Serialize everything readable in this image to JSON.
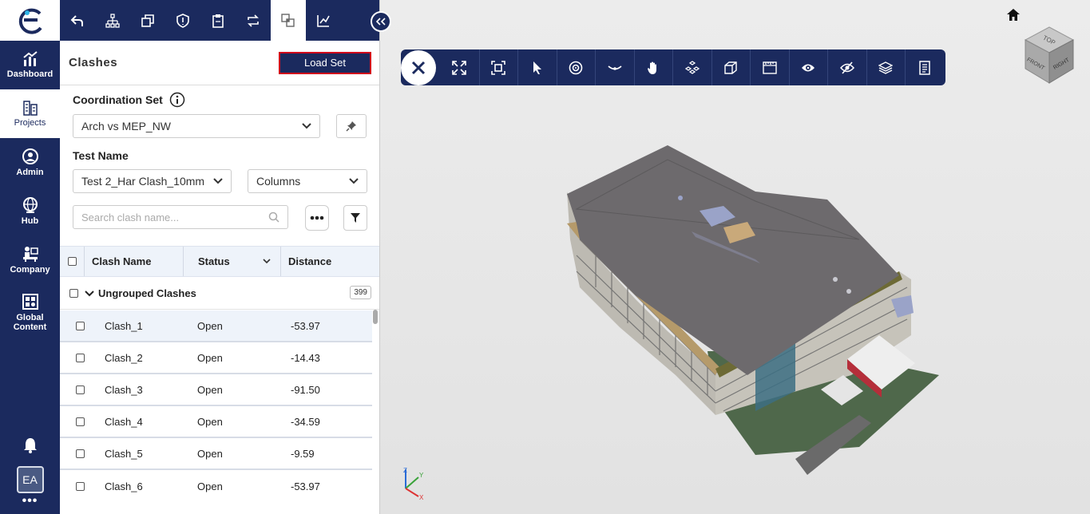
{
  "nav": {
    "items": [
      {
        "label": "Dashboard",
        "icon": "chart-icon"
      },
      {
        "label": "Projects",
        "icon": "buildings-icon"
      },
      {
        "label": "Admin",
        "icon": "admin-icon"
      },
      {
        "label": "Hub",
        "icon": "globe-icon"
      },
      {
        "label": "Company",
        "icon": "company-icon"
      },
      {
        "label": "Global Content",
        "icon": "global-content-icon"
      }
    ],
    "avatar": "EA",
    "more": "•••"
  },
  "panel": {
    "title": "Clashes",
    "load_set": "Load Set",
    "coordination_label": "Coordination Set",
    "coordination_value": "Arch vs MEP_NW",
    "test_label": "Test Name",
    "test_value": "Test 2_Har Clash_10mm",
    "columns_value": "Columns",
    "search_placeholder": "Search clash name...",
    "headers": {
      "name": "Clash Name",
      "status": "Status",
      "distance": "Distance"
    },
    "group": {
      "label": "Ungrouped Clashes",
      "count": "399"
    },
    "rows": [
      {
        "name": "Clash_1",
        "status": "Open",
        "distance": "-53.97"
      },
      {
        "name": "Clash_2",
        "status": "Open",
        "distance": "-14.43"
      },
      {
        "name": "Clash_3",
        "status": "Open",
        "distance": "-91.50"
      },
      {
        "name": "Clash_4",
        "status": "Open",
        "distance": "-34.59"
      },
      {
        "name": "Clash_5",
        "status": "Open",
        "distance": "-9.59"
      },
      {
        "name": "Clash_6",
        "status": "Open",
        "distance": "-53.97"
      }
    ]
  },
  "viewer": {
    "cube": {
      "top": "TOP",
      "front": "FRONT",
      "right": "RIGHT"
    },
    "axes": {
      "x": "X",
      "y": "Y",
      "z": "Z"
    }
  }
}
